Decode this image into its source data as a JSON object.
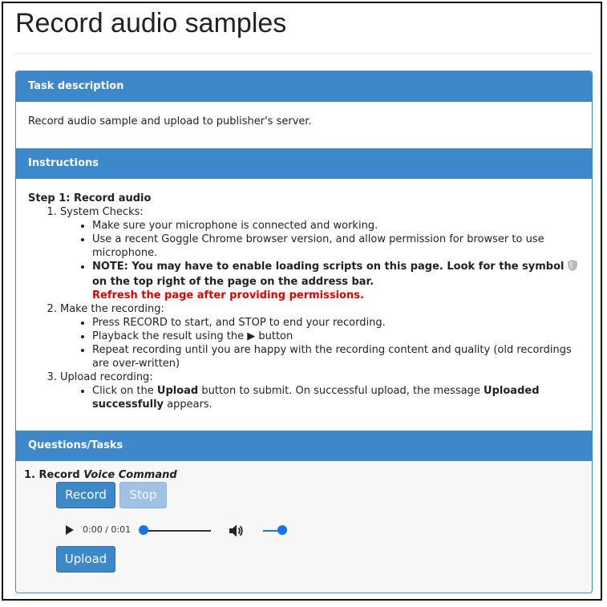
{
  "page": {
    "title": "Record audio samples"
  },
  "task": {
    "heading": "Task description",
    "text": "Record audio sample and upload to publisher's server."
  },
  "instructions": {
    "heading": "Instructions",
    "step_title": "Step 1: Record audio",
    "steps": [
      {
        "label": "System Checks:",
        "bullets": [
          "Make sure your microphone is connected and working.",
          "Use a recent Goggle Chrome browser version, and allow permission for browser to use microphone."
        ],
        "note_before": "NOTE: You may have to enable loading scripts on this page. Look for the symbol",
        "note_after": "on the top right of the page on the address bar.",
        "note_refresh": "Refresh the page after providing permissions."
      },
      {
        "label": "Make the recording:",
        "bullets": [
          "Press RECORD to start, and STOP to end your recording.",
          "Playback the result using the ▶ button",
          "Repeat recording until you are happy with the recording content and quality (old recordings are over-written)"
        ]
      },
      {
        "label": "Upload recording:",
        "upload_parts": [
          "Click on the ",
          "Upload",
          " button to submit. On successful upload, the message ",
          "Uploaded successfully",
          " appears."
        ]
      }
    ]
  },
  "questions": {
    "heading": "Questions/Tasks",
    "item_prefix": "1. Record ",
    "item_name": "Voice Command",
    "record_label": "Record",
    "stop_label": "Stop",
    "upload_label": "Upload",
    "player": {
      "time": "0:00 / 0:01",
      "progress": 0.0,
      "volume": 1.0
    }
  },
  "colors": {
    "accent": "#3d88c8",
    "alert": "#e00000",
    "slider": "#1a73e8"
  }
}
